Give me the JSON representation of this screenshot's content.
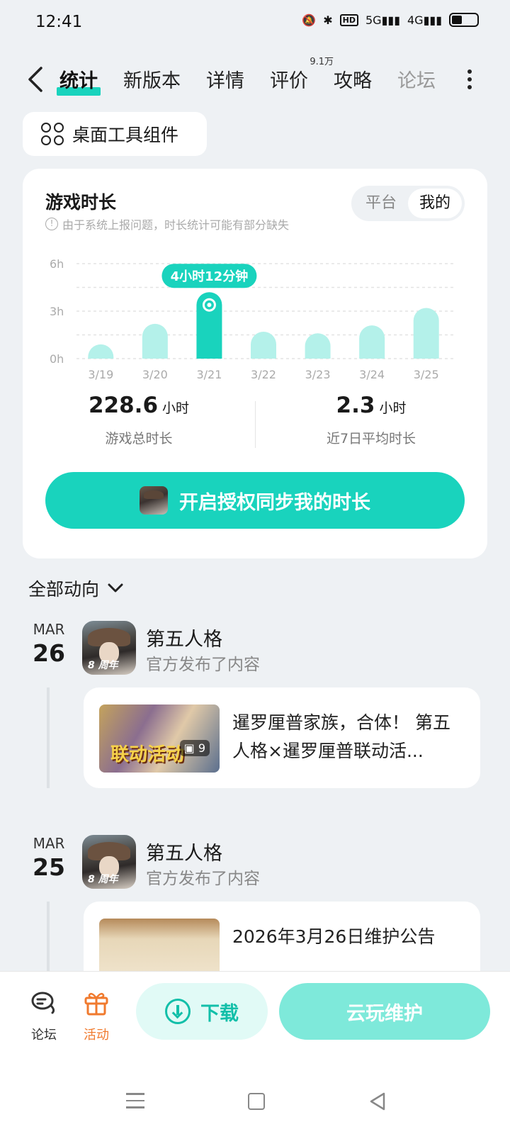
{
  "status_bar": {
    "time": "12:41",
    "net1": "5G",
    "net2": "4G",
    "hd": "HD"
  },
  "nav": {
    "tabs": [
      {
        "label": "统计",
        "active": true
      },
      {
        "label": "新版本"
      },
      {
        "label": "详情"
      },
      {
        "label": "评价",
        "badge": "9.1万"
      },
      {
        "label": "攻略"
      },
      {
        "label": "论坛"
      }
    ]
  },
  "widget_button": {
    "label": "桌面工具组件"
  },
  "play_time": {
    "title": "游戏时长",
    "note": "由于系统上报问题，时长统计可能有部分缺失",
    "toggle": [
      "平台",
      "我的"
    ],
    "toggle_selected": "我的",
    "tooltip": "4小时12分钟",
    "total_value": "228.6",
    "total_unit": "小时",
    "total_label": "游戏总时长",
    "avg_value": "2.3",
    "avg_unit": "小时",
    "avg_label": "近7日平均时长",
    "sync_button": "开启授权同步我的时长"
  },
  "chart_data": {
    "type": "bar",
    "categories": [
      "3/19",
      "3/20",
      "3/21",
      "3/22",
      "3/23",
      "3/24",
      "3/25"
    ],
    "values": [
      0.9,
      2.2,
      4.2,
      1.7,
      1.6,
      2.1,
      3.2
    ],
    "selected_index": 2,
    "y_ticks": [
      "0h",
      "3h",
      "6h"
    ],
    "ylim": [
      0,
      6
    ],
    "bar_color": "#b4f1ea",
    "selected_color": "#19d3bd"
  },
  "feed": {
    "header": "全部动向",
    "entries": [
      {
        "month": "MAR",
        "day": "26",
        "game": "第五人格",
        "action": "官方发布了内容",
        "icon_tag": "8 周年",
        "post_text": "暹罗厘普家族，合体！ 第五人格×暹罗厘普联动活...",
        "thumb_overlay": "联动活动",
        "thumb_count": "9"
      },
      {
        "month": "MAR",
        "day": "25",
        "game": "第五人格",
        "action": "官方发布了内容",
        "icon_tag": "8 周年",
        "post_text": "2026年3月26日维护公告"
      }
    ]
  },
  "bottom_bar": {
    "forum_label": "论坛",
    "activity_label": "活动",
    "download_label": "下载",
    "cloud_label": "云玩维护"
  },
  "colors": {
    "accent": "#19d3bd",
    "orange": "#f07a2e",
    "background": "#eef1f4"
  }
}
